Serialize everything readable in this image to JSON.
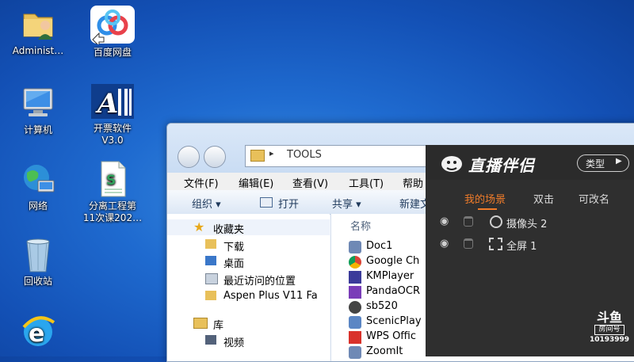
{
  "desktop": {
    "icons": [
      {
        "label": "Administ…"
      },
      {
        "label": "百度网盘"
      },
      {
        "label": "计算机"
      },
      {
        "label": "开票软件\nV3.0",
        "line1": "开票软件",
        "line2": "V3.0"
      },
      {
        "label": "网络"
      },
      {
        "line1": "分离工程第",
        "line2": "11次课202…"
      },
      {
        "label": "回收站"
      }
    ],
    "ie_letter": "e"
  },
  "explorer": {
    "address": "TOOLS",
    "menu": [
      "文件(F)",
      "编辑(E)",
      "查看(V)",
      "工具(T)",
      "帮助"
    ],
    "toolbar": [
      "组织 ▾",
      "打开",
      "共享 ▾",
      "新建文"
    ],
    "nav": {
      "favorites": "收藏夹",
      "items": [
        "下载",
        "桌面",
        "最近访问的位置",
        "Aspen Plus V11 Fa"
      ],
      "library": "库",
      "library_items": [
        "视频"
      ]
    },
    "column_header": "名称",
    "files": [
      "Doc1",
      "Google Ch",
      "KMPlayer",
      "PandaOCR",
      "sb520",
      "ScenicPlay",
      "WPS Offic",
      "ZoomIt"
    ]
  },
  "overlay": {
    "brand": "直播伴侣",
    "type_button": "类型",
    "tabs": [
      "我的场景",
      "双击",
      "可改名"
    ],
    "active_tab_color": "#f07c2a",
    "scenes": [
      {
        "label": "摄像头 2",
        "icon": "camera-icon"
      },
      {
        "label": "全屏 1",
        "icon": "fullscreen-icon"
      }
    ],
    "watermark": {
      "logo": "斗鱼",
      "sub": "房间号",
      "room": "10193999"
    }
  }
}
